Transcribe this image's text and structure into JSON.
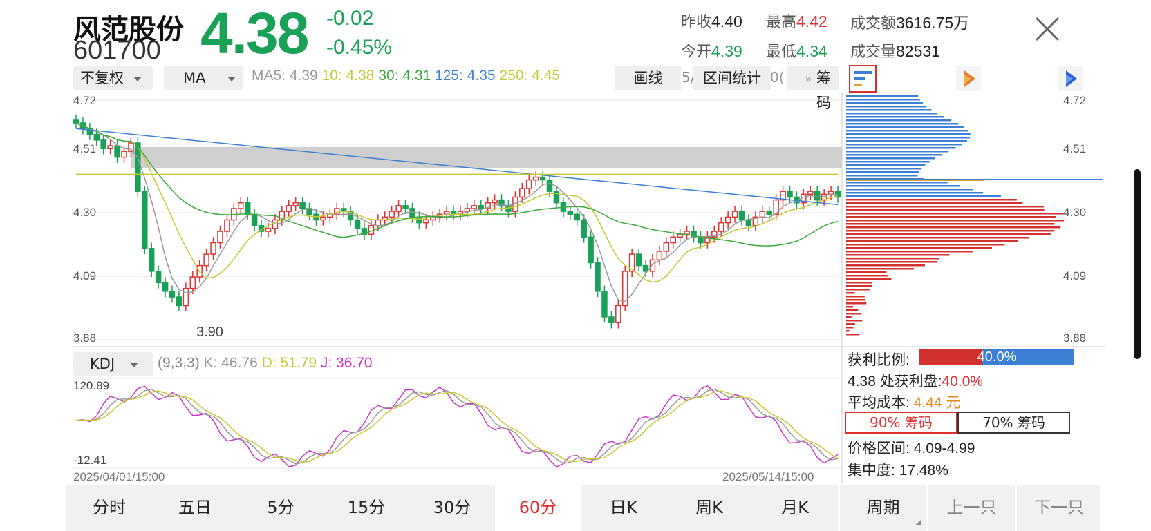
{
  "stock": {
    "name": "风范股份",
    "code": "601700",
    "price": "4.38",
    "change": "-0.02",
    "change_pct": "-0.45%"
  },
  "stats": {
    "prev_close_label": "昨收",
    "prev_close": "4.40",
    "high_label": "最高",
    "high": "4.42",
    "amount_label": "成交额",
    "amount": "3616.75万",
    "open_label": "今开",
    "open": "4.39",
    "low_label": "最低",
    "low": "4.34",
    "volume_label": "成交量",
    "volume": "82531"
  },
  "toolbar": {
    "adjust": "不复权",
    "indicator": "MA",
    "ma5": "MA5: 4.39",
    "ma10": "10: 4.38",
    "ma30": "30: 4.31",
    "ma125": "125: 4.35",
    "ma250": "250: 4.45",
    "draw_label": "画线",
    "range_label": "区间统计",
    "chips_label": "筹码",
    "peek_a": "5/",
    "peek_b": "0("
  },
  "main_chart": {
    "y_ticks": [
      "4.72",
      "4.51",
      "4.30",
      "4.09",
      "3.88"
    ],
    "low_annotation": "3.90"
  },
  "kdj": {
    "name": "KDJ",
    "params": "(9,3,3)",
    "k": "K: 46.76",
    "d": "D: 51.79",
    "j": "J: 36.70",
    "y_max": "120.89",
    "y_min": "-12.41",
    "date_start": "2025/04/01/15:00",
    "date_end": "2025/05/14/15:00"
  },
  "chips": {
    "y_ticks": [
      "4.72",
      "4.51",
      "4.30",
      "4.09",
      "3.88"
    ],
    "profit_label": "获利比例:",
    "profit_value": "40.0%",
    "profit_ratio": 0.4,
    "profit_at_label": "4.38 处获利盘:",
    "profit_at_value": "40.0%",
    "avg_cost_label": "平均成本:",
    "avg_cost_value": "4.44 元",
    "tab_90": "90% 筹码",
    "tab_70": "70% 筹码",
    "range_label": "价格区间:",
    "range_value": "4.09-4.99",
    "concentration_label": "集中度:",
    "concentration_value": "17.48%"
  },
  "periods": [
    "分时",
    "五日",
    "5分",
    "15分",
    "30分",
    "60分",
    "日K",
    "周K",
    "月K"
  ],
  "period_active": "60分",
  "nav": {
    "cycle": "周期",
    "prev": "上一只",
    "next": "下一只"
  },
  "colors": {
    "up": "#e03030",
    "down": "#1aa158",
    "ma5": "#999999",
    "ma10": "#c8c832",
    "ma30": "#3aaa3a",
    "ma125": "#3d7fd4",
    "ma250": "#c8c832",
    "k": "#999999",
    "d": "#c8c832",
    "j": "#cc33cc"
  }
}
